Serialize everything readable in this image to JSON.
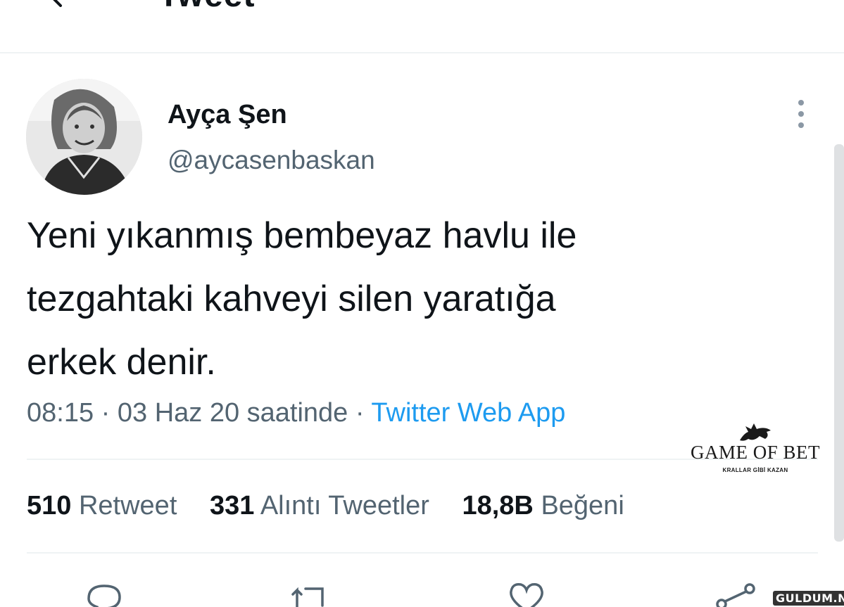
{
  "header": {
    "title": "Tweet",
    "back_icon": "arrow-left-icon"
  },
  "author": {
    "display_name": "Ayça Şen",
    "handle": "@aycasenbaskan",
    "avatar": "avatar-photo"
  },
  "tweet": {
    "lines": [
      "Yeni yıkanmış bembeyaz havlu ile",
      "tezgahtaki kahveyi silen yaratığa",
      "erkek denir."
    ]
  },
  "meta": {
    "time": "08:15 · 03 Haz 20 saatinde · ",
    "source": "Twitter Web App"
  },
  "stats": {
    "retweets": {
      "count": "510",
      "label": "Retweet"
    },
    "quotes": {
      "count": "331",
      "label": "Alıntı Tweetler"
    },
    "likes": {
      "count": "18,8B",
      "label": "Beğeni"
    }
  },
  "watermark": {
    "title": "GAME OF BET",
    "subtitle": "KRALLAR GİBİ KAZAN"
  },
  "site_tag": "GULDUM.NET",
  "actions": [
    "reply-icon",
    "retweet-icon",
    "like-icon",
    "share-icon"
  ],
  "colors": {
    "accent": "#1d9bf0",
    "secondary_text": "#536471",
    "primary_text": "#0f1419",
    "divider": "#eff3f4"
  }
}
